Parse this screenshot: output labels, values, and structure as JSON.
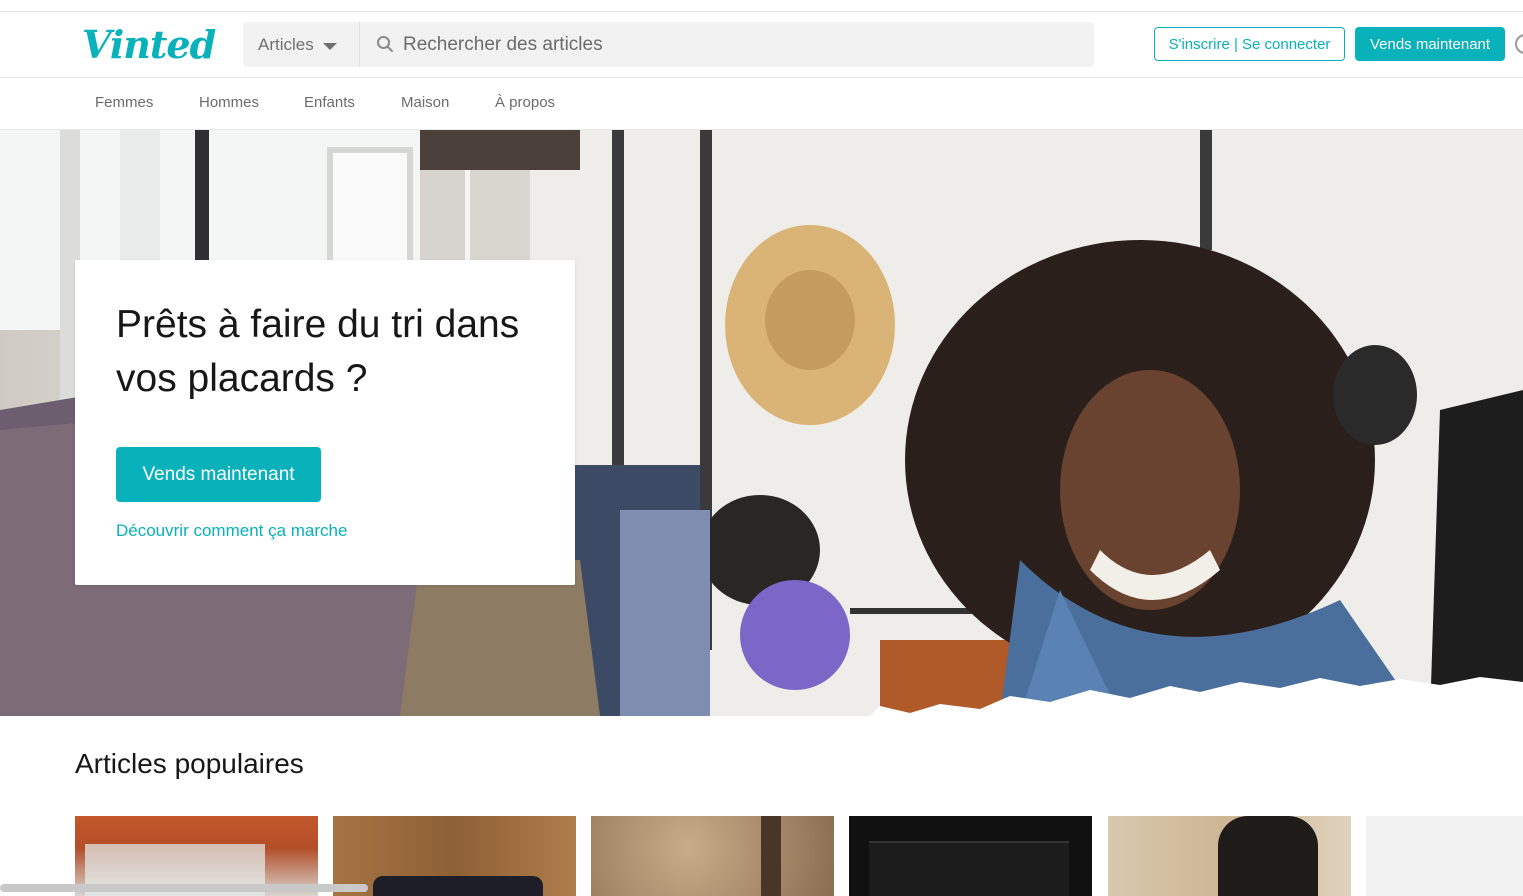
{
  "brand": {
    "logo_text": "Vinted",
    "accent_color": "#09b1ba"
  },
  "header": {
    "category_select": {
      "selected": "Articles",
      "icon": "caret-down-icon"
    },
    "search": {
      "placeholder": "Rechercher des articles",
      "icon": "search-icon"
    },
    "login_button": "S'inscrire | Se connecter",
    "sell_button": "Vends maintenant",
    "help_icon": "help-circle-icon"
  },
  "nav": {
    "items": [
      "Femmes",
      "Hommes",
      "Enfants",
      "Maison",
      "À propos"
    ]
  },
  "hero": {
    "title": "Prêts à faire du tri dans vos placards ?",
    "cta_button": "Vends maintenant",
    "link": "Découvrir comment ça marche"
  },
  "popular": {
    "title": "Articles populaires",
    "items": [
      {
        "kind": "toy-box-photo",
        "colors": [
          "#c4582c",
          "#8a3a1f"
        ]
      },
      {
        "kind": "wood-floor-garment-photo",
        "colors": [
          "#a57443",
          "#5e3a1e"
        ]
      },
      {
        "kind": "leopard-bag-photo",
        "colors": [
          "#b69877",
          "#5a4330"
        ]
      },
      {
        "kind": "dark-garment-photo",
        "colors": [
          "#1a1a1a",
          "#333333"
        ]
      },
      {
        "kind": "person-wearing-top-photo",
        "colors": [
          "#cdb99a",
          "#2a2420"
        ]
      },
      {
        "kind": "placeholder",
        "colors": [
          "#f2f2f2",
          "#f2f2f2"
        ]
      }
    ]
  }
}
